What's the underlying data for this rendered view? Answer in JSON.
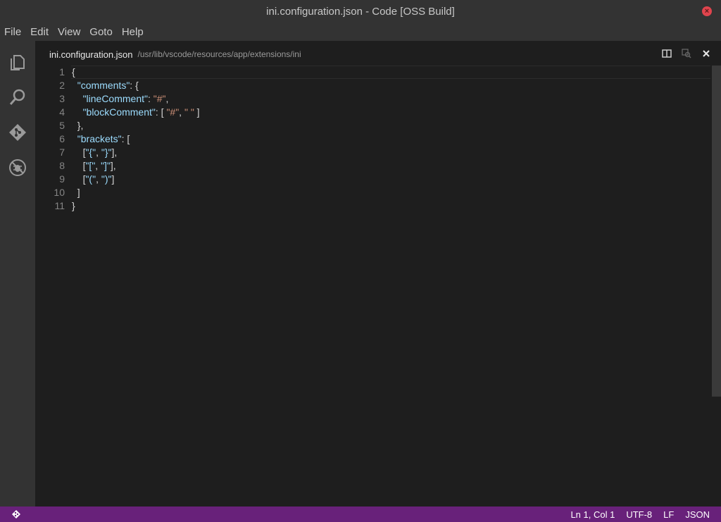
{
  "window": {
    "title": "ini.configuration.json - Code [OSS Build]"
  },
  "menu": [
    "File",
    "Edit",
    "View",
    "Goto",
    "Help"
  ],
  "activity_icons": [
    "files-icon",
    "search-icon",
    "git-icon",
    "debug-icon"
  ],
  "editor": {
    "file_name": "ini.configuration.json",
    "file_path": "/usr/lib/vscode/resources/app/extensions/ini",
    "actions": [
      "split-editor-icon",
      "open-changes-icon",
      "close-icon"
    ],
    "lines": [
      {
        "n": "1",
        "indent": "",
        "parts": [
          [
            "p",
            "{"
          ]
        ]
      },
      {
        "n": "2",
        "indent": "  ",
        "parts": [
          [
            "k",
            "\"comments\""
          ],
          [
            "p",
            ": {"
          ]
        ]
      },
      {
        "n": "3",
        "indent": "    ",
        "parts": [
          [
            "k",
            "\"lineComment\""
          ],
          [
            "p",
            ": "
          ],
          [
            "s",
            "\"#\""
          ],
          [
            "p",
            ","
          ]
        ]
      },
      {
        "n": "4",
        "indent": "    ",
        "parts": [
          [
            "k",
            "\"blockComment\""
          ],
          [
            "p",
            ": [ "
          ],
          [
            "s",
            "\"#\""
          ],
          [
            "p",
            ", "
          ],
          [
            "s",
            "\" \""
          ],
          [
            "p",
            " ]"
          ]
        ]
      },
      {
        "n": "5",
        "indent": "  ",
        "parts": [
          [
            "p",
            "},"
          ]
        ]
      },
      {
        "n": "6",
        "indent": "  ",
        "parts": [
          [
            "k",
            "\"brackets\""
          ],
          [
            "p",
            ": ["
          ]
        ]
      },
      {
        "n": "7",
        "indent": "    ",
        "parts": [
          [
            "p",
            "["
          ],
          [
            "k",
            "\"{\""
          ],
          [
            "p",
            ", "
          ],
          [
            "k",
            "\"}\""
          ],
          [
            "p",
            "],"
          ]
        ]
      },
      {
        "n": "8",
        "indent": "    ",
        "parts": [
          [
            "p",
            "["
          ],
          [
            "k",
            "\"[\""
          ],
          [
            "p",
            ", "
          ],
          [
            "k",
            "\"]\""
          ],
          [
            "p",
            "],"
          ]
        ]
      },
      {
        "n": "9",
        "indent": "    ",
        "parts": [
          [
            "p",
            "["
          ],
          [
            "k",
            "\"(\""
          ],
          [
            "p",
            ", "
          ],
          [
            "k",
            "\")\""
          ],
          [
            "p",
            "]"
          ]
        ]
      },
      {
        "n": "10",
        "indent": "  ",
        "parts": [
          [
            "p",
            "]"
          ]
        ]
      },
      {
        "n": "11",
        "indent": "",
        "parts": [
          [
            "p",
            "}"
          ]
        ]
      }
    ]
  },
  "status": {
    "position": "Ln 1, Col 1",
    "encoding": "UTF-8",
    "eol": "LF",
    "language": "JSON"
  },
  "colors": {
    "status_bar": "#68217a",
    "key": "#9cdcfe",
    "string": "#ce9178",
    "close_button": "#e0444d"
  }
}
